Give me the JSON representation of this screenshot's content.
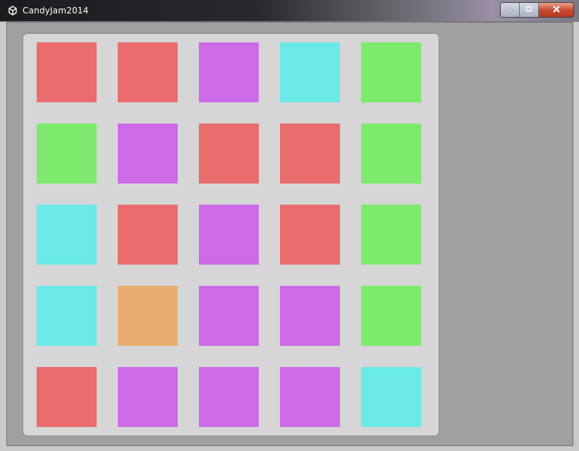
{
  "window": {
    "title": "CandyJam2014",
    "app_icon": "unity-icon",
    "buttons": {
      "minimize": "minimize-icon",
      "maximize": "maximize-icon",
      "close": "close-icon"
    }
  },
  "colors": {
    "red": "#e96d6c",
    "purple": "#cd6be6",
    "cyan": "#6ae9e8",
    "green": "#7dea6d",
    "orange": "#e8ad6e",
    "board_bg": "#d6d6d6",
    "client_bg": "#a0a0a0"
  },
  "board": {
    "rows": 5,
    "cols": 5,
    "grid": [
      [
        "red",
        "red",
        "purple",
        "cyan",
        "green"
      ],
      [
        "green",
        "purple",
        "red",
        "red",
        "green"
      ],
      [
        "cyan",
        "red",
        "purple",
        "red",
        "green"
      ],
      [
        "cyan",
        "orange",
        "purple",
        "purple",
        "green"
      ],
      [
        "red",
        "purple",
        "purple",
        "purple",
        "cyan"
      ]
    ]
  }
}
